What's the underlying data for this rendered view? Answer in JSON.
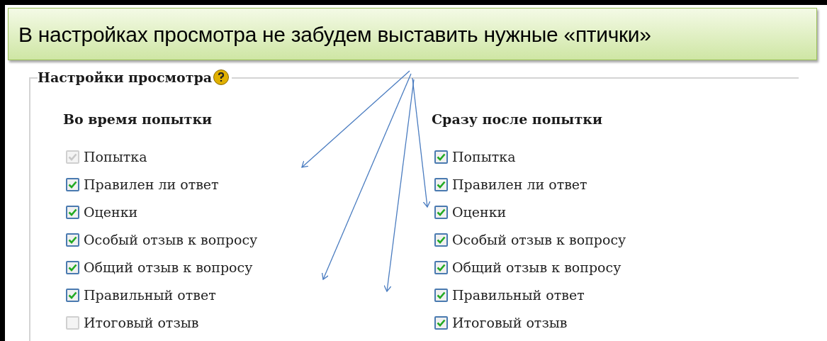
{
  "callout": {
    "text": "В настройках просмотра не забудем выставить нужные «птички»"
  },
  "fieldset": {
    "legend": "Настройки просмотра"
  },
  "columns": [
    {
      "heading": "Во время попытки",
      "items": [
        {
          "label": "Попытка",
          "checked": true,
          "disabled": true
        },
        {
          "label": "Правилен ли ответ",
          "checked": true,
          "disabled": false
        },
        {
          "label": "Оценки",
          "checked": true,
          "disabled": false
        },
        {
          "label": "Особый отзыв к вопросу",
          "checked": true,
          "disabled": false
        },
        {
          "label": "Общий отзыв к вопросу",
          "checked": true,
          "disabled": false
        },
        {
          "label": "Правильный ответ",
          "checked": true,
          "disabled": false
        },
        {
          "label": "Итоговый отзыв",
          "checked": false,
          "disabled": true
        }
      ]
    },
    {
      "heading": "Сразу после попытки",
      "items": [
        {
          "label": "Попытка",
          "checked": true,
          "disabled": false
        },
        {
          "label": "Правилен ли ответ",
          "checked": true,
          "disabled": false
        },
        {
          "label": "Оценки",
          "checked": true,
          "disabled": false
        },
        {
          "label": "Особый отзыв к вопросу",
          "checked": true,
          "disabled": false
        },
        {
          "label": "Общий отзыв к вопросу",
          "checked": true,
          "disabled": false
        },
        {
          "label": "Правильный ответ",
          "checked": true,
          "disabled": false
        },
        {
          "label": "Итоговый отзыв",
          "checked": true,
          "disabled": false
        }
      ]
    }
  ]
}
